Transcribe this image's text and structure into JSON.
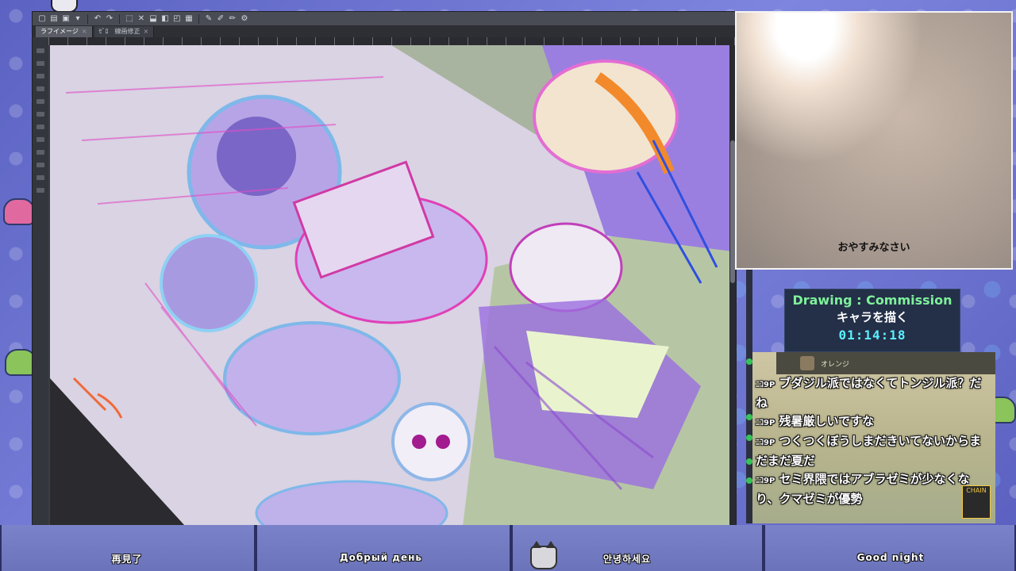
{
  "webcam": {
    "caption": "おやすみなさい"
  },
  "stream_info": {
    "title": "Drawing : Commission",
    "subtitle": "キャラを描く",
    "timer": "01:14:18"
  },
  "chat": {
    "header": "オレンジ",
    "comments": [
      {
        "prefix": "ﾆｺ9",
        "suffix": "P",
        "text": "ブダジル派ではなくてトンジル派？だね"
      },
      {
        "prefix": "ﾆｺ9",
        "suffix": "P",
        "text": "残暑厳しいですな"
      },
      {
        "prefix": "ﾆｺ9",
        "suffix": "P",
        "text": "つくつくぼうしまだきいてないからまだまだ夏だ"
      },
      {
        "prefix": "ﾆｺ9",
        "suffix": "P",
        "text": "セミ界隈ではアブラゼミが少なくなり、クマゼミが優勢"
      }
    ],
    "badge": "CHAIN"
  },
  "bottom_greetings": [
    "再見了",
    "Добрый день",
    "안녕하세요",
    "Good night"
  ],
  "app": {
    "tabs": [
      {
        "label": "ラフイメージ",
        "active": true
      },
      {
        "label": "ｾﾞﾛ　線画修正",
        "active": false
      }
    ]
  },
  "colors": {
    "info_title": "#7ef29a",
    "info_timer": "#59f0ff",
    "background": "#6a6fc8"
  }
}
